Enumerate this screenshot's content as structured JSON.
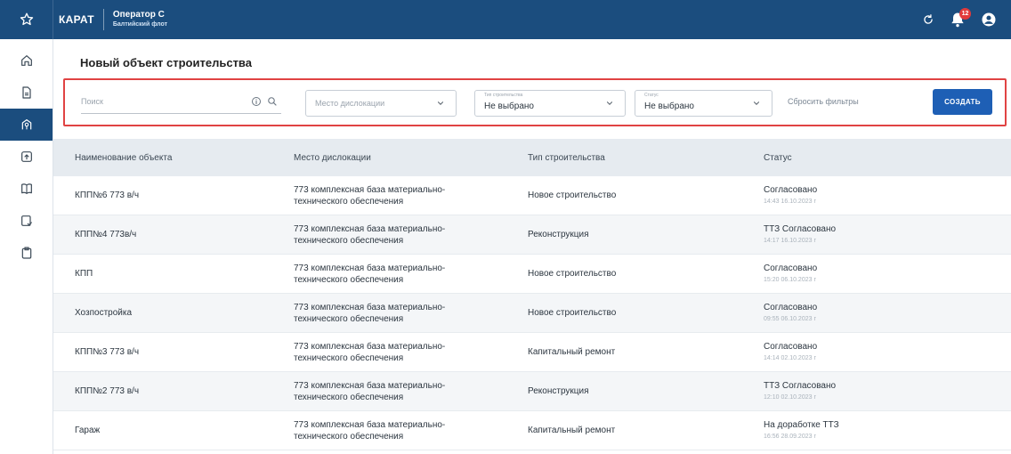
{
  "app": {
    "brand": "КАРАТ",
    "operator_name": "Оператор С",
    "operator_unit": "Балтийский флот",
    "notifications_count": "12"
  },
  "page": {
    "title": "Новый объект строительства"
  },
  "filters": {
    "search_placeholder": "Поиск",
    "location_placeholder": "Место дислокации",
    "construction_type_label": "Тип строительства",
    "construction_type_value": "Не выбрано",
    "status_label": "Статус",
    "status_value": "Не выбрано",
    "reset_label": "Сбросить фильтры",
    "create_label": "СОЗДАТЬ"
  },
  "table": {
    "headers": [
      "Наименование объекта",
      "Место дислокации",
      "Тип строительства",
      "Статус"
    ],
    "rows": [
      {
        "name": "КПП№6 773 в/ч",
        "location_1": "773 комплексная база материально-",
        "location_2": "технического обеспечения",
        "type": "Новое строительство",
        "status": "Согласовано",
        "time": "14:43 16.10.2023 г"
      },
      {
        "name": "КПП№4 773в/ч",
        "location_1": "773 комплексная база материально-",
        "location_2": "технического обеспечения",
        "type": "Реконструкция",
        "status": "ТТЗ Согласовано",
        "time": "14:17 16.10.2023 г"
      },
      {
        "name": "КПП",
        "location_1": "773 комплексная база материально-",
        "location_2": "технического обеспечения",
        "type": "Новое строительство",
        "status": "Согласовано",
        "time": "15:20 06.10.2023 г"
      },
      {
        "name": "Хозпостройка",
        "location_1": "773 комплексная база материально-",
        "location_2": "технического обеспечения",
        "type": "Новое строительство",
        "status": "Согласовано",
        "time": "09:55 06.10.2023 г"
      },
      {
        "name": "КПП№3 773 в/ч",
        "location_1": "773 комплексная база материально-",
        "location_2": "технического обеспечения",
        "type": "Капитальный ремонт",
        "status": "Согласовано",
        "time": "14:14 02.10.2023 г"
      },
      {
        "name": "КПП№2 773 в/ч",
        "location_1": "773 комплексная база материально-",
        "location_2": "технического обеспечения",
        "type": "Реконструкция",
        "status": "ТТЗ Согласовано",
        "time": "12:10 02.10.2023 г"
      },
      {
        "name": "Гараж",
        "location_1": "773 комплексная база материально-",
        "location_2": "технического обеспечения",
        "type": "Капитальный ремонт",
        "status": "На доработке ТТЗ",
        "time": "16:56 28.09.2023 г"
      }
    ]
  },
  "icons": {
    "sidebar": [
      "home-icon",
      "document-icon",
      "map-pin-icon",
      "upload-icon",
      "book-icon",
      "checklist-icon",
      "clipboard-icon"
    ],
    "top": [
      "star-icon",
      "refresh-icon",
      "bell-icon",
      "user-icon"
    ]
  },
  "colors": {
    "topbar": "#1b4d7e",
    "accent": "#1e5fb5",
    "highlight_border": "#e04343",
    "header_row": "#e6ebf0"
  }
}
